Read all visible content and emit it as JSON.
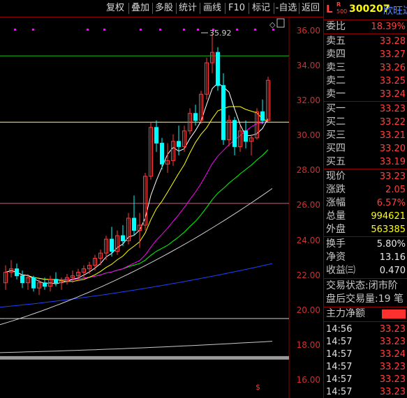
{
  "toolbar": {
    "items": [
      "复权",
      "叠加",
      "多股",
      "统计",
      "画线",
      "F10",
      "标记",
      "-自选",
      "返回"
    ]
  },
  "chart": {
    "price_ticks": [
      "36.00",
      "34.00",
      "32.00",
      "30.00",
      "28.00",
      "26.00",
      "24.00",
      "22.00",
      "20.00",
      "18.00",
      "16.00"
    ],
    "high_label": "35.92",
    "bottom_marker": "$",
    "colors": {
      "up": "#ff3c3c",
      "down": "#00ffff",
      "ma5": "#ffffff",
      "ma10": "#ffff00",
      "ma20": "#ff00ff",
      "ma30": "#00ff00",
      "ma60": "#d0d0d0",
      "ma120": "#2040ff",
      "ma250": "#c8c8c8",
      "hline_green": "#00cc00",
      "hline_yellow": "#ffff80",
      "hline_magenta": "#ff3c8c",
      "hline_white": "#d0d0d0"
    }
  },
  "chart_data": {
    "type": "candlestick",
    "x": [],
    "ylim": [
      15.0,
      36.8
    ],
    "grid": false,
    "series": [
      {
        "values": [
          [
            21.6,
            22.6,
            21.2,
            22.2
          ],
          [
            22.2,
            22.9,
            21.9,
            22.4
          ],
          [
            22.4,
            22.7,
            21.8,
            22.0
          ],
          [
            22.0,
            22.3,
            21.3,
            21.6
          ],
          [
            21.6,
            22.1,
            21.2,
            21.9
          ],
          [
            21.9,
            22.0,
            21.1,
            21.3
          ],
          [
            21.3,
            21.8,
            20.9,
            21.6
          ],
          [
            21.6,
            21.9,
            21.2,
            21.4
          ],
          [
            21.4,
            22.0,
            21.1,
            21.8
          ],
          [
            21.8,
            22.2,
            21.4,
            21.6
          ],
          [
            21.6,
            21.9,
            21.2,
            21.7
          ],
          [
            21.7,
            22.1,
            21.5,
            21.9
          ],
          [
            21.9,
            22.3,
            21.6,
            22.0
          ],
          [
            22.0,
            22.4,
            21.7,
            22.2
          ],
          [
            22.2,
            22.6,
            21.9,
            22.4
          ],
          [
            22.4,
            22.8,
            22.1,
            22.6
          ],
          [
            22.6,
            23.2,
            22.3,
            23.0
          ],
          [
            23.0,
            23.5,
            22.6,
            23.3
          ],
          [
            23.3,
            24.3,
            22.9,
            24.1
          ],
          [
            24.1,
            24.8,
            23.1,
            23.4
          ],
          [
            23.4,
            24.6,
            23.2,
            24.3
          ],
          [
            24.3,
            24.9,
            23.7,
            24.0
          ],
          [
            24.0,
            25.6,
            23.8,
            25.3
          ],
          [
            25.3,
            26.6,
            24.3,
            24.6
          ],
          [
            24.6,
            25.6,
            23.6,
            24.9
          ],
          [
            24.9,
            27.9,
            24.6,
            27.7
          ],
          [
            27.7,
            30.8,
            27.5,
            30.5
          ],
          [
            30.5,
            30.9,
            29.1,
            29.6
          ],
          [
            29.6,
            29.9,
            28.1,
            28.4
          ],
          [
            28.4,
            29.6,
            27.9,
            28.6
          ],
          [
            28.6,
            30.1,
            28.3,
            29.7
          ],
          [
            29.7,
            30.6,
            28.9,
            29.4
          ],
          [
            29.4,
            30.6,
            29.1,
            30.3
          ],
          [
            30.3,
            31.6,
            30.1,
            31.3
          ],
          [
            31.3,
            31.8,
            30.6,
            30.9
          ],
          [
            30.9,
            32.6,
            30.7,
            32.4
          ],
          [
            32.4,
            34.5,
            32.1,
            34.2
          ],
          [
            34.2,
            35.9,
            33.6,
            34.8
          ],
          [
            34.8,
            35.1,
            32.6,
            32.9
          ],
          [
            32.9,
            33.6,
            29.5,
            29.8
          ],
          [
            29.8,
            31.2,
            29.4,
            30.9
          ],
          [
            30.9,
            31.1,
            28.9,
            29.4
          ],
          [
            29.4,
            30.6,
            29.1,
            30.3
          ],
          [
            30.3,
            30.9,
            29.3,
            29.7
          ],
          [
            29.7,
            30.1,
            28.9,
            29.9
          ],
          [
            29.9,
            31.6,
            29.8,
            31.4
          ],
          [
            31.4,
            32.1,
            30.7,
            30.9
          ],
          [
            30.9,
            33.4,
            30.9,
            33.2
          ]
        ]
      }
    ]
  },
  "quote": {
    "stock": {
      "flag": "L",
      "r_flag": "R",
      "board": "500",
      "code": "300207",
      "name": "欣旺达"
    },
    "weibi": {
      "label": "委比",
      "value": "18.39%"
    },
    "asks": [
      {
        "label": "卖五",
        "price": "33.28"
      },
      {
        "label": "卖四",
        "price": "33.27"
      },
      {
        "label": "卖三",
        "price": "33.26"
      },
      {
        "label": "卖二",
        "price": "33.25"
      },
      {
        "label": "卖一",
        "price": "33.24"
      }
    ],
    "bids": [
      {
        "label": "买一",
        "price": "33.23"
      },
      {
        "label": "买二",
        "price": "33.22"
      },
      {
        "label": "买三",
        "price": "33.21"
      },
      {
        "label": "买四",
        "price": "33.20"
      },
      {
        "label": "买五",
        "price": "33.19"
      }
    ],
    "stats": [
      {
        "label": "现价",
        "value": "33.23"
      },
      {
        "label": "涨跌",
        "value": "2.05"
      },
      {
        "label": "涨幅",
        "value": "6.57%"
      },
      {
        "label": "总量",
        "value": "994621"
      },
      {
        "label": "外盘",
        "value": "563385"
      }
    ],
    "stats2": [
      {
        "label": "换手",
        "value": "5.80%"
      },
      {
        "label": "净资",
        "value": "13.16"
      },
      {
        "label": "收益㈢",
        "value": "0.470"
      }
    ],
    "trade_status": {
      "label": "交易状态:",
      "value": "闭市阶"
    },
    "after_hours": {
      "label": "盘后交易量:",
      "value": "19 笔"
    },
    "main_flow": {
      "label": "主力净额"
    },
    "ticks": [
      {
        "time": "14:56",
        "price": "33.23"
      },
      {
        "time": "14:57",
        "price": "33.23"
      },
      {
        "time": "14:57",
        "price": "33.24"
      },
      {
        "time": "14:57",
        "price": "33.23"
      },
      {
        "time": "14:57",
        "price": "33.23"
      },
      {
        "time": "14:57",
        "price": "33.23"
      }
    ]
  }
}
